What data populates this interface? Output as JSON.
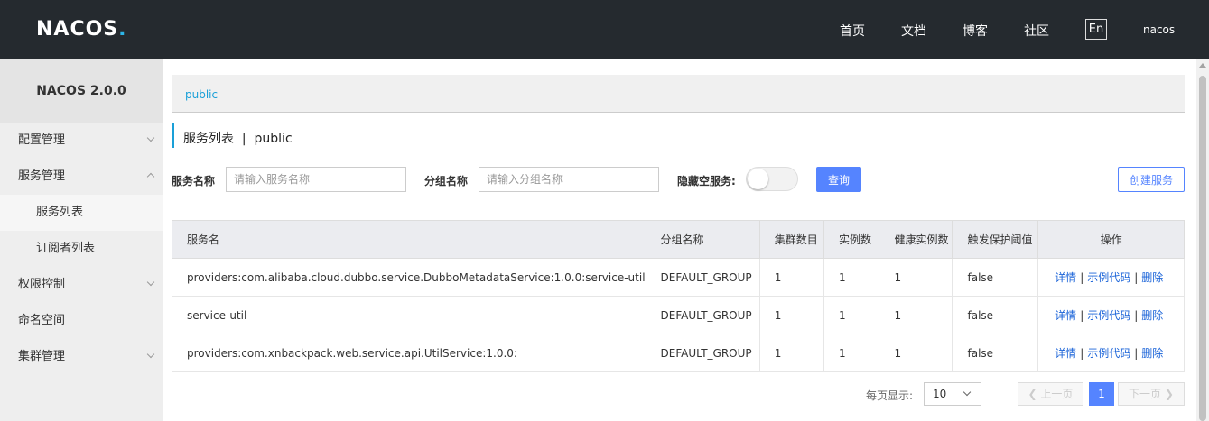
{
  "header": {
    "logo": "NACOS",
    "logo_dot": ".",
    "nav": [
      "首页",
      "文档",
      "博客",
      "社区"
    ],
    "lang": "En",
    "user": "nacos"
  },
  "sidebar": {
    "title": "NACOS 2.0.0",
    "items": [
      {
        "label": "配置管理"
      },
      {
        "label": "服务管理"
      },
      {
        "label": "服务列表"
      },
      {
        "label": "订阅者列表"
      },
      {
        "label": "权限控制"
      },
      {
        "label": "命名空间"
      },
      {
        "label": "集群管理"
      }
    ]
  },
  "namespace_bar": {
    "label": "public"
  },
  "page_title": "服务列表  |  public",
  "filters": {
    "service_name_label": "服务名称",
    "service_name_placeholder": "请输入服务名称",
    "group_name_label": "分组名称",
    "group_name_placeholder": "请输入分组名称",
    "hide_empty_label": "隐藏空服务:",
    "query_button": "查询",
    "create_button": "创建服务"
  },
  "table": {
    "headers": [
      "服务名",
      "分组名称",
      "集群数目",
      "实例数",
      "健康实例数",
      "触发保护阈值",
      "操作"
    ],
    "rows": [
      [
        "providers:com.alibaba.cloud.dubbo.service.DubboMetadataService:1.0.0:service-util",
        "DEFAULT_GROUP",
        "1",
        "1",
        "1",
        "false"
      ],
      [
        "service-util",
        "DEFAULT_GROUP",
        "1",
        "1",
        "1",
        "false"
      ],
      [
        "providers:com.xnbackpack.web.service.api.UtilService:1.0.0:",
        "DEFAULT_GROUP",
        "1",
        "1",
        "1",
        "false"
      ]
    ],
    "actions": [
      "详情",
      "示例代码",
      "删除"
    ],
    "action_sep": "|"
  },
  "pagination": {
    "label": "每页显示:",
    "page_size": "10",
    "prev": "上一页",
    "current": "1",
    "next": "下一页"
  }
}
